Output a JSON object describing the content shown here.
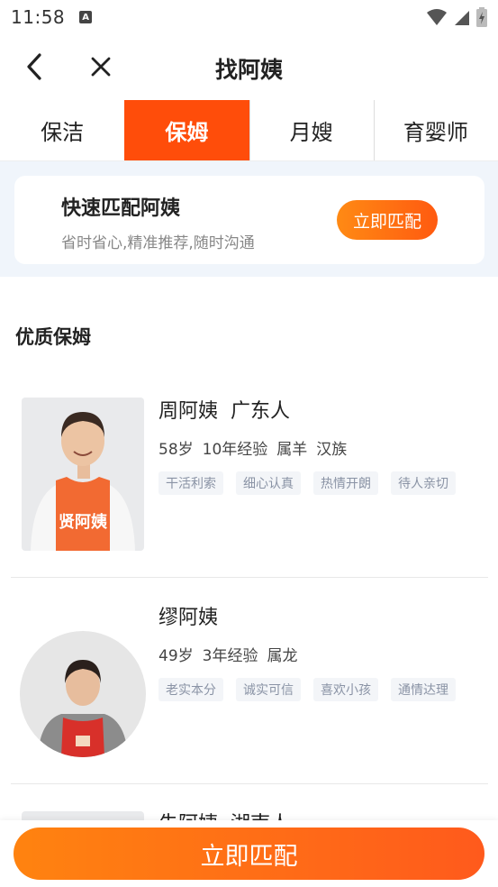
{
  "status": {
    "time": "11:58",
    "notification_icon": "A"
  },
  "nav": {
    "title": "找阿姨"
  },
  "tabs": [
    {
      "label": "保洁",
      "active": false
    },
    {
      "label": "保姆",
      "active": true
    },
    {
      "label": "月嫂",
      "active": false
    },
    {
      "label": "育婴师",
      "active": false
    }
  ],
  "quick_match": {
    "title": "快速匹配阿姨",
    "subtitle": "省时省心,精准推荐,随时沟通",
    "button": "立即匹配"
  },
  "section": {
    "title": "优质保姆"
  },
  "workers": [
    {
      "name": "周阿姨",
      "origin": "广东人",
      "age": "58岁",
      "experience": "10年经验",
      "zodiac": "属羊",
      "ethnicity": "汉族",
      "tags": [
        "干活利索",
        "细心认真",
        "热情开朗",
        "待人亲切"
      ],
      "apron_text": "贤阿姨"
    },
    {
      "name": "缪阿姨",
      "origin": "",
      "age": "49岁",
      "experience": "3年经验",
      "zodiac": "属龙",
      "ethnicity": "",
      "tags": [
        "老实本分",
        "诚实可信",
        "喜欢小孩",
        "通情达理"
      ]
    },
    {
      "name": "朱阿姨",
      "origin": "湖南人"
    }
  ],
  "bottom": {
    "button": "立即匹配"
  },
  "colors": {
    "accent": "#ff4d0a",
    "button_start": "#ff8310",
    "button_end": "#ff5a1c",
    "tag_bg": "#f3f5f8",
    "tag_text": "#8a93a5"
  },
  "icons": {
    "back": "chevron-left-icon",
    "close": "close-icon",
    "wifi": "wifi-icon",
    "signal": "signal-icon",
    "battery": "battery-icon"
  }
}
